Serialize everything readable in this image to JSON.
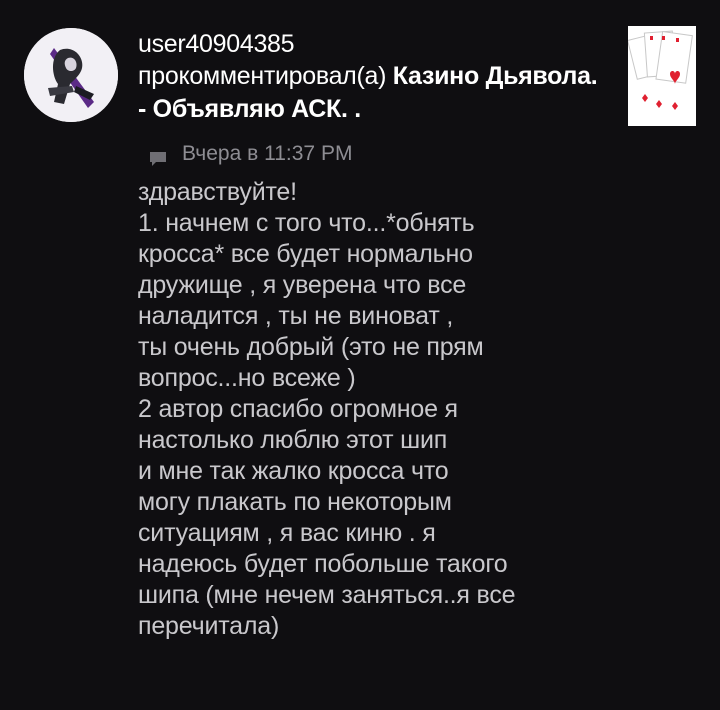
{
  "comment": {
    "username": "user40904385",
    "action": "прокомментировал(а)",
    "target": "Казино Дьявола. - Объявляю АСК. .",
    "timestamp": "Вчера в 11:37 PM",
    "body_lines": [
      "здравствуйте!",
      "1. начнем с того что...*обнять",
      "кросса* все будет нормально",
      "дружище , я уверена что все",
      "наладится , ты не виноват ,",
      "ты очень добрый (это не прям",
      "вопрос...но всеже )",
      "2 автор спасибо огромное я",
      "настолько люблю этот шип",
      "и мне так жалко кросса что",
      "могу плакать по некоторым",
      "ситуациям , я вас киню . я",
      "надеюсь будет побольше такого",
      "шипа (мне нечем заняться..я все",
      "перечитала)"
    ]
  },
  "icons": {
    "avatar": "user-avatar",
    "comment": "comment-icon",
    "thumbnail": "playing-cards-icon"
  },
  "colors": {
    "background": "#0f0e11",
    "text_primary": "#ffffff",
    "text_body": "#c9c8cc",
    "text_meta": "#8e8d93",
    "card_red": "#e02030"
  }
}
